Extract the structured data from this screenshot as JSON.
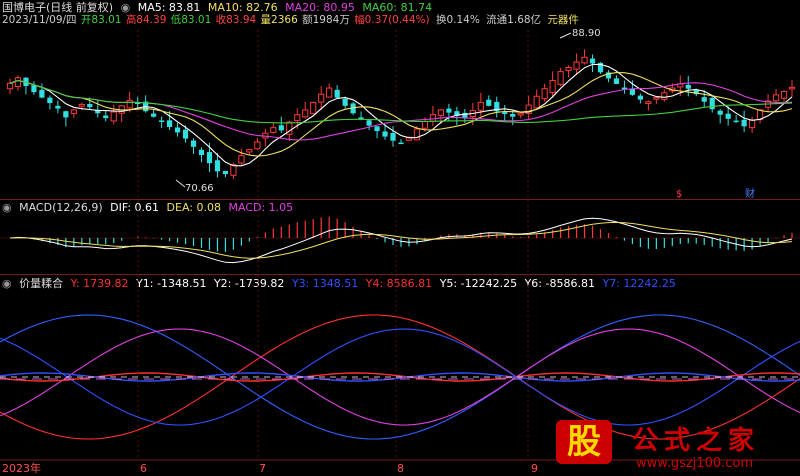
{
  "header": {
    "title": "国博电子(日线 前复权)",
    "ma_labels": [
      {
        "text": "MA5: 83.81",
        "color": "#ffffff"
      },
      {
        "text": "MA10: 82.76",
        "color": "#f0e060"
      },
      {
        "text": "MA20: 80.95",
        "color": "#e040e0"
      },
      {
        "text": "MA60: 81.74",
        "color": "#40d040"
      }
    ],
    "quote": [
      {
        "text": "2023/11/09/四",
        "color": "#cccccc"
      },
      {
        "text": "开83.01",
        "color": "#40d040"
      },
      {
        "text": "高84.39",
        "color": "#ff4040"
      },
      {
        "text": "低83.01",
        "color": "#40d040"
      },
      {
        "text": "收83.94",
        "color": "#ff4040"
      },
      {
        "text": "量2366",
        "color": "#f0e060"
      },
      {
        "text": "额1984万",
        "color": "#cccccc"
      },
      {
        "text": "幅0.37(0.44%)",
        "color": "#ff4040"
      },
      {
        "text": "换0.14%",
        "color": "#cccccc"
      },
      {
        "text": "流通1.68亿",
        "color": "#cccccc"
      },
      {
        "text": "元器件",
        "color": "#f0e060"
      }
    ],
    "high_mark": "88.90",
    "low_mark": "70.66",
    "flag_s": "$",
    "flag_cai": "财"
  },
  "macd": {
    "title": "MACD(12,26,9)",
    "items": [
      {
        "text": "DIF: 0.61",
        "color": "#ffffff"
      },
      {
        "text": "DEA: 0.08",
        "color": "#f0e060"
      },
      {
        "text": "MACD: 1.05",
        "color": "#e040e0"
      }
    ]
  },
  "jlzh": {
    "title": "价量糅合",
    "items": [
      {
        "text": "Y: 1739.82",
        "color": "#ff3030"
      },
      {
        "text": "Y1: -1348.51",
        "color": "#ffffff"
      },
      {
        "text": "Y2: -1739.82",
        "color": "#ffffff"
      },
      {
        "text": "Y3: 1348.51",
        "color": "#3050ff"
      },
      {
        "text": "Y4: 8586.81",
        "color": "#ff3030"
      },
      {
        "text": "Y5: -12242.25",
        "color": "#ffffff"
      },
      {
        "text": "Y6: -8586.81",
        "color": "#ffffff"
      },
      {
        "text": "Y7: 12242.25",
        "color": "#3050ff"
      }
    ]
  },
  "xaxis": {
    "labels": [
      "2023年",
      "6",
      "7",
      "8",
      "9"
    ]
  },
  "watermark": {
    "logo": "股",
    "text": "公式之家",
    "url": "www.gszj100.com"
  },
  "chart_data": [
    {
      "type": "candlestick",
      "title": "国博电子(日线 前复权)",
      "ylim": [
        68,
        92
      ],
      "annotations": [
        {
          "label": "88.90",
          "type": "high"
        },
        {
          "label": "70.66",
          "type": "low"
        }
      ],
      "closes": [
        84.5,
        85.3,
        84.1,
        83.2,
        82.4,
        81.6,
        80.8,
        79.5,
        80.6,
        81.4,
        81.0,
        80.1,
        79.4,
        80.3,
        81.2,
        82.0,
        81.5,
        80.4,
        79.6,
        78.9,
        78.1,
        77.3,
        76.4,
        75.2,
        74.0,
        72.8,
        71.6,
        71.2,
        72.6,
        73.9,
        74.8,
        75.9,
        77.2,
        78.0,
        77.6,
        78.8,
        79.9,
        80.6,
        81.7,
        82.9,
        83.8,
        82.4,
        81.2,
        80.1,
        79.2,
        78.3,
        77.5,
        76.7,
        76.1,
        75.7,
        76.6,
        77.8,
        78.9,
        79.9,
        80.6,
        80.2,
        79.7,
        79.4,
        80.5,
        81.7,
        81.2,
        80.4,
        80.0,
        79.6,
        80.1,
        81.3,
        82.6,
        83.7,
        84.9,
        86.2,
        86.8,
        87.6,
        88.3,
        87.4,
        86.1,
        85.2,
        84.4,
        83.6,
        82.8,
        82.1,
        81.8,
        82.4,
        83.1,
        83.8,
        84.4,
        83.7,
        82.9,
        81.8,
        80.7,
        79.9,
        79.3,
        78.9,
        78.2,
        79.1,
        80.6,
        81.9,
        82.8,
        83.3,
        83.9
      ],
      "ma": [
        {
          "name": "MA5",
          "value": 83.81,
          "color": "#ffffff"
        },
        {
          "name": "MA10",
          "value": 82.76,
          "color": "#f0e060"
        },
        {
          "name": "MA20",
          "value": 80.95,
          "color": "#e040e0"
        },
        {
          "name": "MA60",
          "value": 81.74,
          "color": "#40d040"
        }
      ]
    },
    {
      "type": "bar",
      "title": "MACD(12,26,9)",
      "series": [
        {
          "name": "DIF",
          "last": 0.61,
          "color": "#ffffff"
        },
        {
          "name": "DEA",
          "last": 0.08,
          "color": "#f0e060"
        },
        {
          "name": "MACD",
          "last": 1.05,
          "color": "#e040e0"
        }
      ]
    },
    {
      "type": "line",
      "title": "价量糅合",
      "series": [
        {
          "name": "Y",
          "last": 1739.82,
          "color": "#ff3030"
        },
        {
          "name": "Y1",
          "last": -1348.51,
          "color": "#ffffff"
        },
        {
          "name": "Y2",
          "last": -1739.82,
          "color": "#ffffff"
        },
        {
          "name": "Y3",
          "last": 1348.51,
          "color": "#3050ff"
        },
        {
          "name": "Y4",
          "last": 8586.81,
          "color": "#ff3030"
        },
        {
          "name": "Y5",
          "last": -12242.25,
          "color": "#ffffff"
        },
        {
          "name": "Y6",
          "last": -8586.81,
          "color": "#ffffff"
        },
        {
          "name": "Y7",
          "last": 12242.25,
          "color": "#3050ff"
        }
      ]
    }
  ]
}
